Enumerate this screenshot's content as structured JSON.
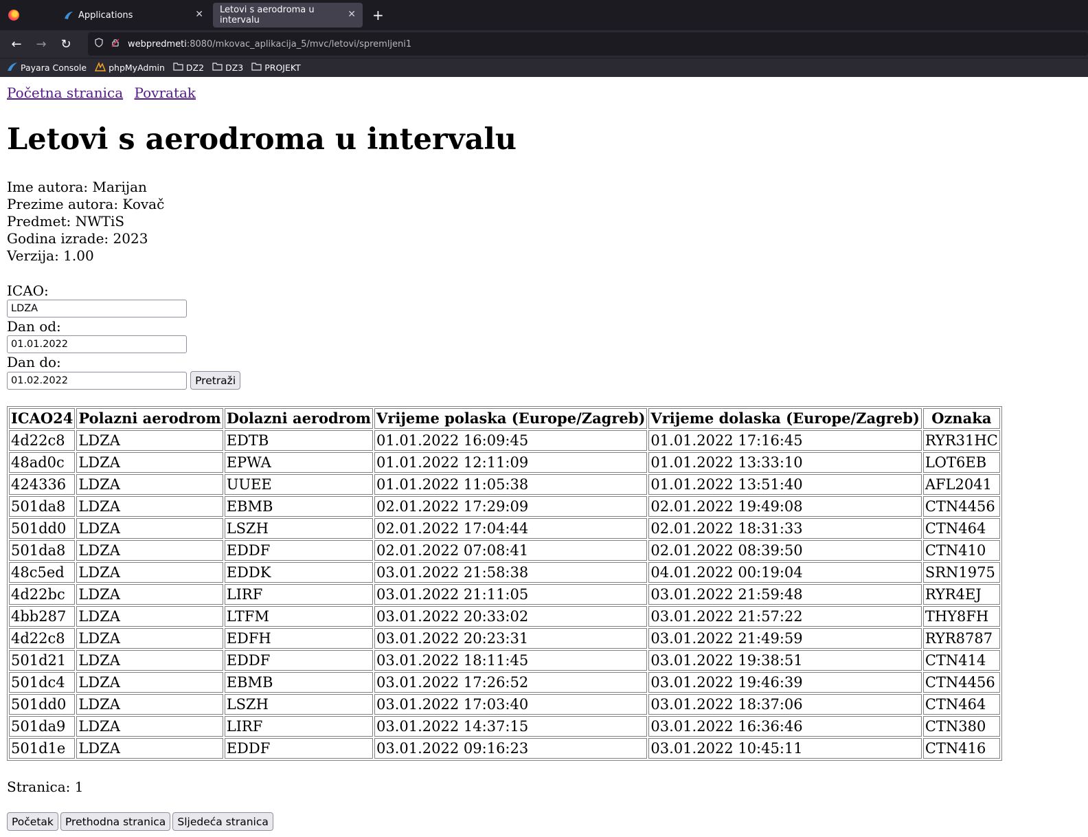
{
  "browser": {
    "tabs": [
      {
        "title": "Applications",
        "active": false
      },
      {
        "title": "Letovi s aerodroma u intervalu",
        "active": true
      }
    ],
    "url_host": "webpredmeti",
    "url_rest": ":8080/mkovac_aplikacija_5/mvc/letovi/spremljeni1",
    "bookmarks": [
      "Payara Console",
      "phpMyAdmin",
      "DZ2",
      "DZ3",
      "PROJEKT"
    ]
  },
  "nav": {
    "home_link": "Početna stranica",
    "back_link": "Povratak"
  },
  "page": {
    "title": "Letovi s aerodroma u intervalu",
    "author_name": "Ime autora: Marijan",
    "author_surname": "Prezime autora: Kovač",
    "course": "Predmet: NWTiS",
    "year": "Godina izrade: 2023",
    "version": "Verzija: 1.00"
  },
  "form": {
    "icao_label": "ICAO:",
    "icao_value": "LDZA",
    "from_label": "Dan od:",
    "from_value": "01.01.2022",
    "to_label": "Dan do:",
    "to_value": "01.02.2022",
    "search_button": "Pretraži"
  },
  "table": {
    "headers": [
      "ICAO24",
      "Polazni aerodrom",
      "Dolazni aerodrom",
      "Vrijeme polaska (Europe/Zagreb)",
      "Vrijeme dolaska (Europe/Zagreb)",
      "Oznaka"
    ],
    "rows": [
      [
        "4d22c8",
        "LDZA",
        "EDTB",
        "01.01.2022 16:09:45",
        "01.01.2022 17:16:45",
        "RYR31HC"
      ],
      [
        "48ad0c",
        "LDZA",
        "EPWA",
        "01.01.2022 12:11:09",
        "01.01.2022 13:33:10",
        "LOT6EB"
      ],
      [
        "424336",
        "LDZA",
        "UUEE",
        "01.01.2022 11:05:38",
        "01.01.2022 13:51:40",
        "AFL2041"
      ],
      [
        "501da8",
        "LDZA",
        "EBMB",
        "02.01.2022 17:29:09",
        "02.01.2022 19:49:08",
        "CTN4456"
      ],
      [
        "501dd0",
        "LDZA",
        "LSZH",
        "02.01.2022 17:04:44",
        "02.01.2022 18:31:33",
        "CTN464"
      ],
      [
        "501da8",
        "LDZA",
        "EDDF",
        "02.01.2022 07:08:41",
        "02.01.2022 08:39:50",
        "CTN410"
      ],
      [
        "48c5ed",
        "LDZA",
        "EDDK",
        "03.01.2022 21:58:38",
        "04.01.2022 00:19:04",
        "SRN1975"
      ],
      [
        "4d22bc",
        "LDZA",
        "LIRF",
        "03.01.2022 21:11:05",
        "03.01.2022 21:59:48",
        "RYR4EJ"
      ],
      [
        "4bb287",
        "LDZA",
        "LTFM",
        "03.01.2022 20:33:02",
        "03.01.2022 21:57:22",
        "THY8FH"
      ],
      [
        "4d22c8",
        "LDZA",
        "EDFH",
        "03.01.2022 20:23:31",
        "03.01.2022 21:49:59",
        "RYR8787"
      ],
      [
        "501d21",
        "LDZA",
        "EDDF",
        "03.01.2022 18:11:45",
        "03.01.2022 19:38:51",
        "CTN414"
      ],
      [
        "501dc4",
        "LDZA",
        "EBMB",
        "03.01.2022 17:26:52",
        "03.01.2022 19:46:39",
        "CTN4456"
      ],
      [
        "501dd0",
        "LDZA",
        "LSZH",
        "03.01.2022 17:03:40",
        "03.01.2022 18:37:06",
        "CTN464"
      ],
      [
        "501da9",
        "LDZA",
        "LIRF",
        "03.01.2022 14:37:15",
        "03.01.2022 16:36:46",
        "CTN380"
      ],
      [
        "501d1e",
        "LDZA",
        "EDDF",
        "03.01.2022 09:16:23",
        "03.01.2022 10:45:11",
        "CTN416"
      ]
    ]
  },
  "pagination": {
    "page_label": "Stranica: 1",
    "first_button": "Početak",
    "prev_button": "Prethodna stranica",
    "next_button": "Sljedeća stranica"
  }
}
